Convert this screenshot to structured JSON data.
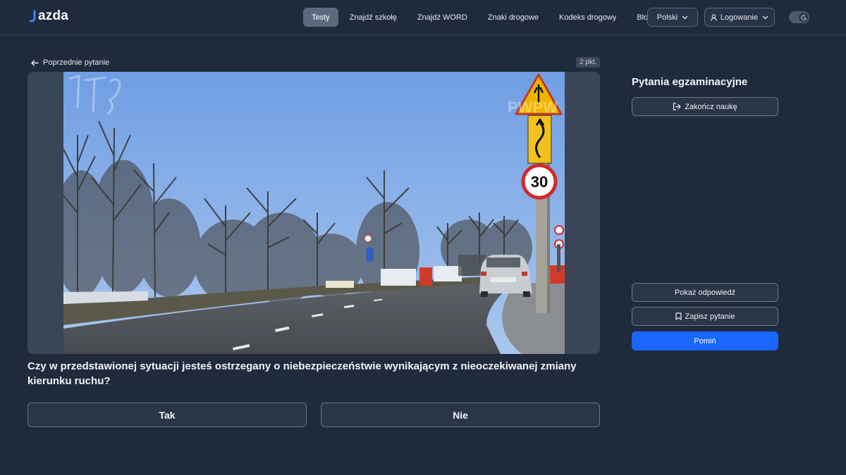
{
  "header": {
    "logo_text": "azda",
    "nav": [
      {
        "label": "Testy",
        "active": true
      },
      {
        "label": "Znajdź szkołę",
        "active": false
      },
      {
        "label": "Znajdź WORD",
        "active": false
      },
      {
        "label": "Znaki drogowe",
        "active": false
      },
      {
        "label": "Kodeks drogowy",
        "active": false
      },
      {
        "label": "Blog",
        "active": false
      }
    ],
    "language": "Polski",
    "login": "Logowanie",
    "theme_toggle_icon": "moon-icon"
  },
  "main": {
    "back_label": "Poprzednie pytanie",
    "points_badge": "2 pkt.",
    "question_text": "Czy w przedstawionej sytuacji jesteś ostrzegany o niebezpieczeństwie wynikającym z nieoczekiwanej zmiany kierunku ruchu?",
    "answers": {
      "yes": "Tak",
      "no": "Nie"
    },
    "image": {
      "speed_limit": "30",
      "watermark": "PWPW"
    }
  },
  "sidebar": {
    "title": "Pytania egzaminacyjne",
    "end_button": "Zakończ naukę",
    "show_answer_button": "Pokaż odpowiedź",
    "save_question_button": "Zapisz pytanie",
    "skip_button": "Pomiń"
  },
  "colors": {
    "background": "#1f2a3c",
    "primary_button": "#1967ff",
    "active_nav": "#5c6a7f"
  }
}
